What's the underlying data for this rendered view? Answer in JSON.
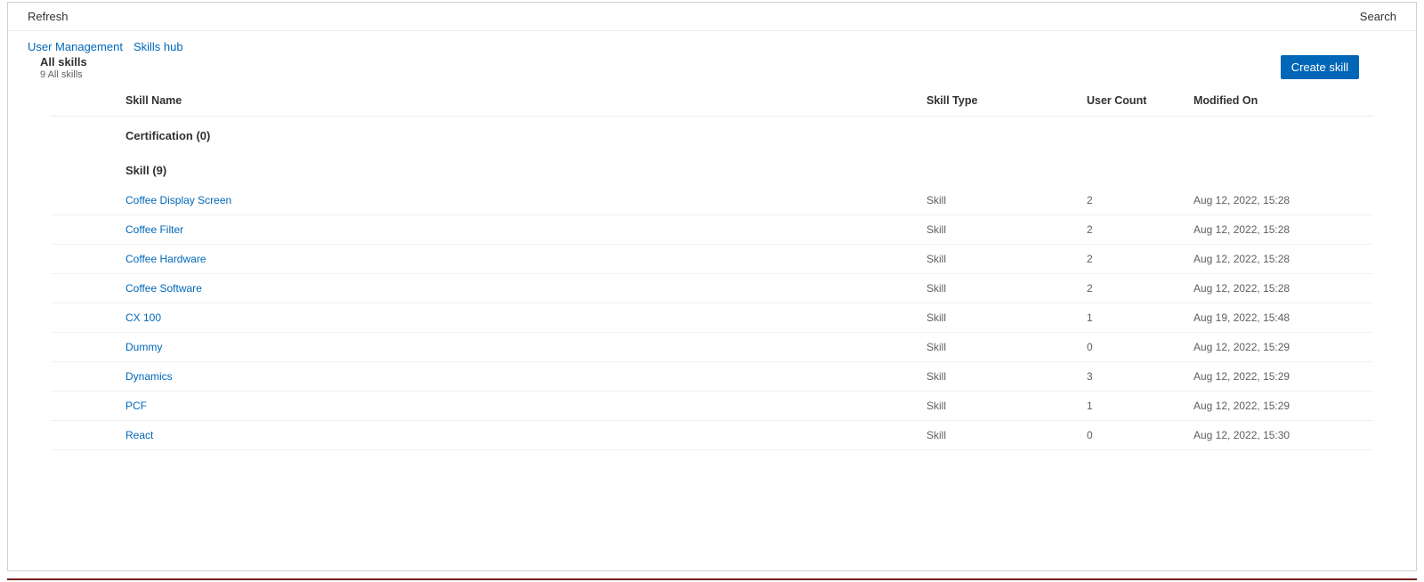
{
  "commandBar": {
    "refresh": "Refresh",
    "search": "Search"
  },
  "breadcrumb": {
    "item1": "User Management",
    "item2": "Skills hub"
  },
  "header": {
    "title": "All skills",
    "subtitle": "9 All skills",
    "createButton": "Create skill"
  },
  "columns": {
    "name": "Skill Name",
    "type": "Skill Type",
    "count": "User Count",
    "modified": "Modified On"
  },
  "groups": {
    "certification": "Certification (0)",
    "skill": "Skill (9)"
  },
  "rows": [
    {
      "name": "Coffee Display Screen",
      "type": "Skill",
      "count": "2",
      "modified": "Aug 12, 2022, 15:28"
    },
    {
      "name": "Coffee Filter",
      "type": "Skill",
      "count": "2",
      "modified": "Aug 12, 2022, 15:28"
    },
    {
      "name": "Coffee Hardware",
      "type": "Skill",
      "count": "2",
      "modified": "Aug 12, 2022, 15:28"
    },
    {
      "name": "Coffee Software",
      "type": "Skill",
      "count": "2",
      "modified": "Aug 12, 2022, 15:28"
    },
    {
      "name": "CX 100",
      "type": "Skill",
      "count": "1",
      "modified": "Aug 19, 2022, 15:48"
    },
    {
      "name": "Dummy",
      "type": "Skill",
      "count": "0",
      "modified": "Aug 12, 2022, 15:29"
    },
    {
      "name": "Dynamics",
      "type": "Skill",
      "count": "3",
      "modified": "Aug 12, 2022, 15:29"
    },
    {
      "name": "PCF",
      "type": "Skill",
      "count": "1",
      "modified": "Aug 12, 2022, 15:29"
    },
    {
      "name": "React",
      "type": "Skill",
      "count": "0",
      "modified": "Aug 12, 2022, 15:30"
    }
  ]
}
